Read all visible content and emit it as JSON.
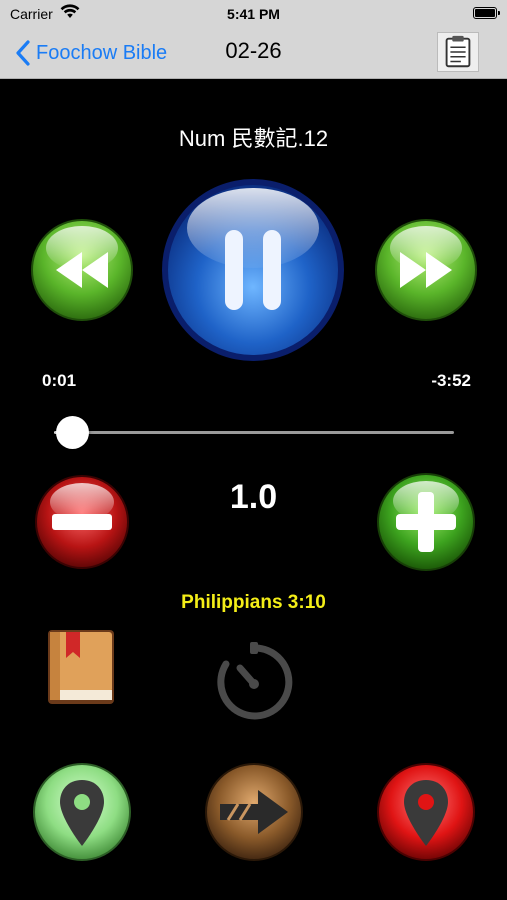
{
  "status_bar": {
    "carrier": "Carrier",
    "time": "5:41 PM"
  },
  "nav": {
    "back_label": "Foochow Bible",
    "title": "02-26"
  },
  "player": {
    "track_title": "Num 民數記.12",
    "elapsed": "0:01",
    "remaining": "-3:52",
    "progress": 0.004,
    "speed": "1.0",
    "verse_ref": "Philippians 3:10"
  },
  "icons": {
    "back": "chevron-left-icon",
    "clipboard": "clipboard-icon",
    "rewind": "rewind-icon",
    "pause": "pause-icon",
    "fast_forward": "fast-forward-icon",
    "minus": "minus-icon",
    "plus": "plus-icon",
    "book": "bookmark-book-icon",
    "timer": "timer-icon",
    "pin_green": "location-pin-icon",
    "next": "arrow-right-icon",
    "pin_red": "location-pin-icon"
  },
  "colors": {
    "nav_background": "#d6d6d6",
    "link_blue": "#1a7cf5",
    "verse_yellow": "#f4ee18",
    "pause_blue": "#1f63c8",
    "green_button": "#5ab52a",
    "red_button": "#b81414",
    "brown_button": "#8a5a2a"
  }
}
